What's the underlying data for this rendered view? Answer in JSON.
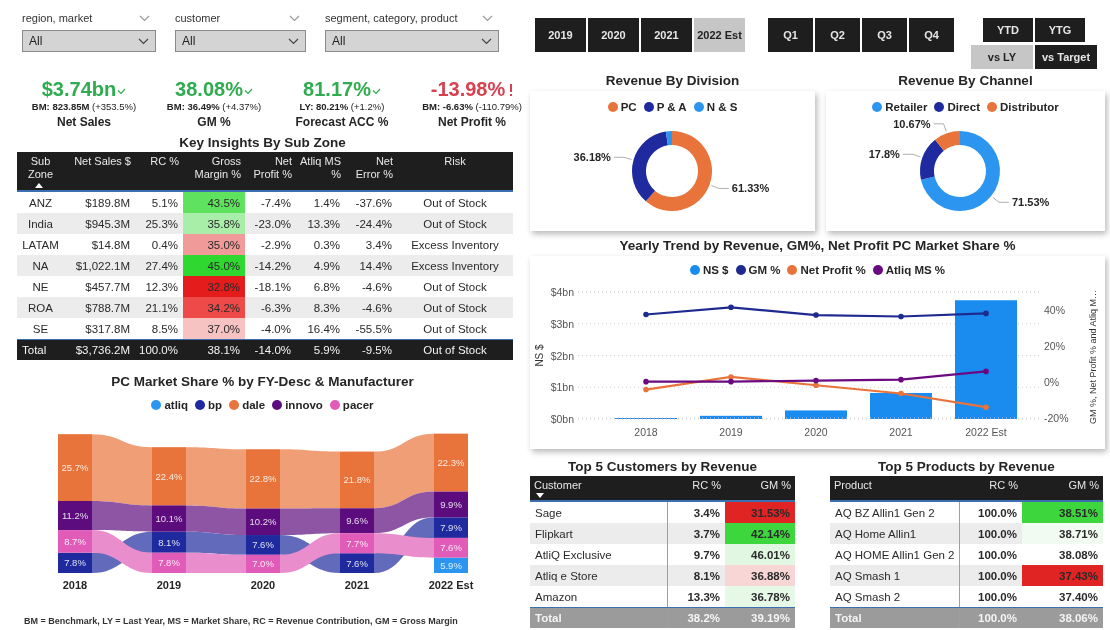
{
  "filters": [
    {
      "label": "region, market",
      "value": "All"
    },
    {
      "label": "customer",
      "value": "All"
    },
    {
      "label": "segment, category, product",
      "value": "All"
    }
  ],
  "kpis": [
    {
      "value": "$3.74bn",
      "on_target": true,
      "benchmark": "**BM: 823.85M** (+353.5%)",
      "label": "Net Sales"
    },
    {
      "value": "38.08%",
      "on_target": true,
      "benchmark": "**BM: 36.49%** (+4.37%)",
      "label": "GM %"
    },
    {
      "value": "81.17%",
      "on_target": true,
      "benchmark": "**LY: 80.21%** (+1.2%)",
      "label": "Forecast ACC %"
    },
    {
      "value": "-13.98%",
      "on_target": false,
      "benchmark": "**BM: -6.63%** (-110.79%)",
      "label": "Net Profit %"
    }
  ],
  "sub_zone_table": {
    "title": "Key Insights By Sub Zone",
    "columns": [
      {
        "label": "Sub Zone",
        "sorted_ascending": true
      },
      {
        "label": "Net Sales $"
      },
      {
        "label": "RC %"
      },
      {
        "label": "Gross Margin %"
      },
      {
        "label": "Net Profit %"
      },
      {
        "label": "Atliq MS %"
      },
      {
        "label": "Net Error %"
      },
      {
        "label": "Risk"
      }
    ],
    "rows": [
      {
        "cells": [
          "ANZ",
          "$189.8M",
          "5.1%",
          "43.5%",
          "-7.4%",
          "1.4%",
          "-37.6%",
          "Out of Stock"
        ],
        "color": "#5fe35f"
      },
      {
        "cells": [
          "India",
          "$945.3M",
          "25.3%",
          "35.8%",
          "-23.0%",
          "13.3%",
          "-24.4%",
          "Out of Stock"
        ],
        "color": "#a8eea8"
      },
      {
        "cells": [
          "LATAM",
          "$14.8M",
          "0.4%",
          "35.0%",
          "-2.9%",
          "0.3%",
          "3.4%",
          "Excess Inventory"
        ],
        "color": "#f09a9a"
      },
      {
        "cells": [
          "NA",
          "$1,022.1M",
          "27.4%",
          "45.0%",
          "-14.2%",
          "4.9%",
          "14.4%",
          "Excess Inventory"
        ],
        "color": "#2fd82f"
      },
      {
        "cells": [
          "NE",
          "$457.7M",
          "12.3%",
          "32.8%",
          "-18.1%",
          "6.8%",
          "-4.6%",
          "Out of Stock"
        ],
        "color": "#e41c1c"
      },
      {
        "cells": [
          "ROA",
          "$788.7M",
          "21.1%",
          "34.2%",
          "-6.3%",
          "8.3%",
          "-4.6%",
          "Out of Stock"
        ],
        "color": "#ee4a4a"
      },
      {
        "cells": [
          "SE",
          "$317.8M",
          "8.5%",
          "37.0%",
          "-4.0%",
          "16.4%",
          "-55.5%",
          "Out of Stock"
        ],
        "color": "#f7c2c2"
      }
    ],
    "total": [
      "Total",
      "$3,736.2M",
      "100.0%",
      "38.1%",
      "-14.0%",
      "5.9%",
      "-9.5%",
      "Out of Stock"
    ]
  },
  "market_share": {
    "chart_data": {
      "type": "bar",
      "stacked": true,
      "title": "PC Market Share % by FY-Desc & Manufacturer",
      "categories": [
        "2018",
        "2019",
        "2020",
        "2021",
        "2022 Est"
      ],
      "series": [
        {
          "name": "atliq",
          "color": "#2b95f0",
          "values": [
            null,
            null,
            null,
            null,
            5.9
          ],
          "value_labels": [
            null,
            null,
            null,
            null,
            "5.9%"
          ]
        },
        {
          "name": "bp",
          "color": "#1e2a9e",
          "values": [
            7.8,
            8.1,
            7.6,
            7.6,
            7.9
          ],
          "value_labels": [
            "7.8%",
            "8.1%",
            "7.6%",
            "7.6%",
            "7.9%"
          ]
        },
        {
          "name": "dale",
          "color": "#e8743b",
          "values": [
            25.7,
            22.4,
            22.8,
            21.8,
            22.3
          ],
          "value_labels": [
            "25.7%",
            "22.4%",
            "22.8%",
            "21.8%",
            "22.3%"
          ]
        },
        {
          "name": "innovo",
          "color": "#5c0c7c",
          "values": [
            11.2,
            10.1,
            10.2,
            9.6,
            9.9
          ],
          "value_labels": [
            "11.2%",
            "10.1%",
            "10.2%",
            "9.6%",
            "9.9%"
          ]
        },
        {
          "name": "pacer",
          "color": "#e05cb8",
          "values": [
            8.7,
            7.8,
            7.0,
            7.7,
            7.6
          ],
          "value_labels": [
            "8.7%",
            "7.8%",
            "7.0%",
            "7.7%",
            "7.6%"
          ]
        }
      ]
    }
  },
  "footnote": "BM = Benchmark, LY = Last Year, MS = Market Share, RC = Revenue Contribution, GM = Gross Margin",
  "year_buttons": [
    {
      "label": "2019",
      "selected": false
    },
    {
      "label": "2020",
      "selected": false
    },
    {
      "label": "2021",
      "selected": false
    },
    {
      "label": "2022 Est",
      "selected": true
    }
  ],
  "quarter_buttons": [
    {
      "label": "Q1",
      "selected": false
    },
    {
      "label": "Q2",
      "selected": false
    },
    {
      "label": "Q3",
      "selected": false
    },
    {
      "label": "Q4",
      "selected": false
    }
  ],
  "period_buttons": [
    {
      "label": "YTD",
      "selected": false
    },
    {
      "label": "YTG",
      "selected": false
    }
  ],
  "compare_buttons": [
    {
      "label": "vs LY",
      "selected": true
    },
    {
      "label": "vs Target",
      "selected": false
    }
  ],
  "donuts": [
    {
      "chart_data": {
        "type": "donut",
        "title": "Revenue By Division",
        "categories": [
          "PC",
          "P & A",
          "N & S"
        ],
        "values": [
          61.33,
          36.18,
          2.49
        ],
        "colors": [
          "#e8743b",
          "#1e2a9e",
          "#2b95f0"
        ],
        "value_labels": [
          "61.33%",
          "36.18%",
          null
        ]
      }
    },
    {
      "chart_data": {
        "type": "donut",
        "title": "Revenue By Channel",
        "categories": [
          "Retailer",
          "Direct",
          "Distributor"
        ],
        "values": [
          71.53,
          17.8,
          10.67
        ],
        "colors": [
          "#2b95f0",
          "#1e2a9e",
          "#e8743b"
        ],
        "value_labels": [
          "71.53%",
          "17.8%",
          "10.67%"
        ]
      }
    }
  ],
  "trend": {
    "title": "Yearly Trend by Revenue, GM%, Net Profit PC Market Share %",
    "bars": {
      "chart_data": {
        "type": "bar",
        "grid": true,
        "categories": [
          "2018",
          "2019",
          "2020",
          "2021",
          "2022 Est"
        ],
        "ylabel": "NS $",
        "ylim": [
          0,
          4
        ],
        "yticks": [
          {
            "value": 0,
            "label": "$0bn"
          },
          {
            "value": 1,
            "label": "$1bn"
          },
          {
            "value": 2,
            "label": "$2bn"
          },
          {
            "value": 3,
            "label": "$3bn"
          },
          {
            "value": 4,
            "label": "$4bn"
          }
        ],
        "series": [
          {
            "name": "NS $",
            "color": "#1a8cf0",
            "values": [
              0.02,
              0.1,
              0.27,
              0.82,
              3.74
            ]
          }
        ]
      }
    },
    "lines": {
      "chart_data": {
        "type": "line",
        "ylabel": "GM %, Net Profit % and Atliq M…",
        "ylim": [
          -20,
          50
        ],
        "yticks": [
          {
            "value": -20,
            "label": "-20%"
          },
          {
            "value": 0,
            "label": "0%"
          },
          {
            "value": 20,
            "label": "20%"
          },
          {
            "value": 40,
            "label": "40%"
          }
        ],
        "series": [
          {
            "name": "GM %",
            "color": "#1e2a8f",
            "values": [
              37.5,
              41.5,
              37.2,
              36.4,
              38.1
            ]
          },
          {
            "name": "Net Profit %",
            "color": "#e8743b",
            "values": [
              -4.2,
              2.8,
              -1.8,
              -6.4,
              -14
            ]
          },
          {
            "name": "Atliq MS %",
            "color": "#6b0a80",
            "values": [
              0.2,
              0.2,
              0.8,
              1.3,
              5.9
            ]
          }
        ]
      }
    }
  },
  "customers_table": {
    "title": "Top 5 Customers by Revenue",
    "columns": [
      {
        "label": "Customer",
        "sorted_descending": true
      },
      {
        "label": "RC %"
      },
      {
        "label": "GM %"
      }
    ],
    "rows": [
      {
        "cells": [
          "Sage",
          "3.4%",
          "31.53%"
        ],
        "color": "#e02424"
      },
      {
        "cells": [
          "Flipkart",
          "3.7%",
          "42.14%"
        ],
        "color": "#3dd63d"
      },
      {
        "cells": [
          "AtliQ Exclusive",
          "9.7%",
          "46.01%"
        ],
        "color": "#e2f7e2"
      },
      {
        "cells": [
          "Atliq e Store",
          "8.1%",
          "36.88%"
        ],
        "color": "#f8d6d6"
      },
      {
        "cells": [
          "Amazon",
          "13.3%",
          "36.78%"
        ],
        "color": "#e6f8e6"
      }
    ],
    "total": [
      "Total",
      "38.2%",
      "39.19%"
    ]
  },
  "products_table": {
    "title": "Top 5 Products by Revenue",
    "columns": [
      {
        "label": "Product"
      },
      {
        "label": "RC %"
      },
      {
        "label": "GM %"
      }
    ],
    "rows": [
      {
        "cells": [
          "AQ BZ Allin1 Gen 2",
          "100.0%",
          "38.51%"
        ],
        "color": "#3dd63d"
      },
      {
        "cells": [
          "AQ Home Allin1",
          "100.0%",
          "38.71%"
        ],
        "color": "#f2fbf2"
      },
      {
        "cells": [
          "AQ HOME Allin1 Gen 2",
          "100.0%",
          "38.08%"
        ],
        "color": "#ffffff"
      },
      {
        "cells": [
          "AQ Smash 1",
          "100.0%",
          "37.43%"
        ],
        "color": "#e02424"
      },
      {
        "cells": [
          "AQ Smash 2",
          "100.0%",
          "37.40%"
        ],
        "color": "#ffffff"
      }
    ],
    "total": [
      "Total",
      "100.0%",
      "38.06%"
    ]
  }
}
